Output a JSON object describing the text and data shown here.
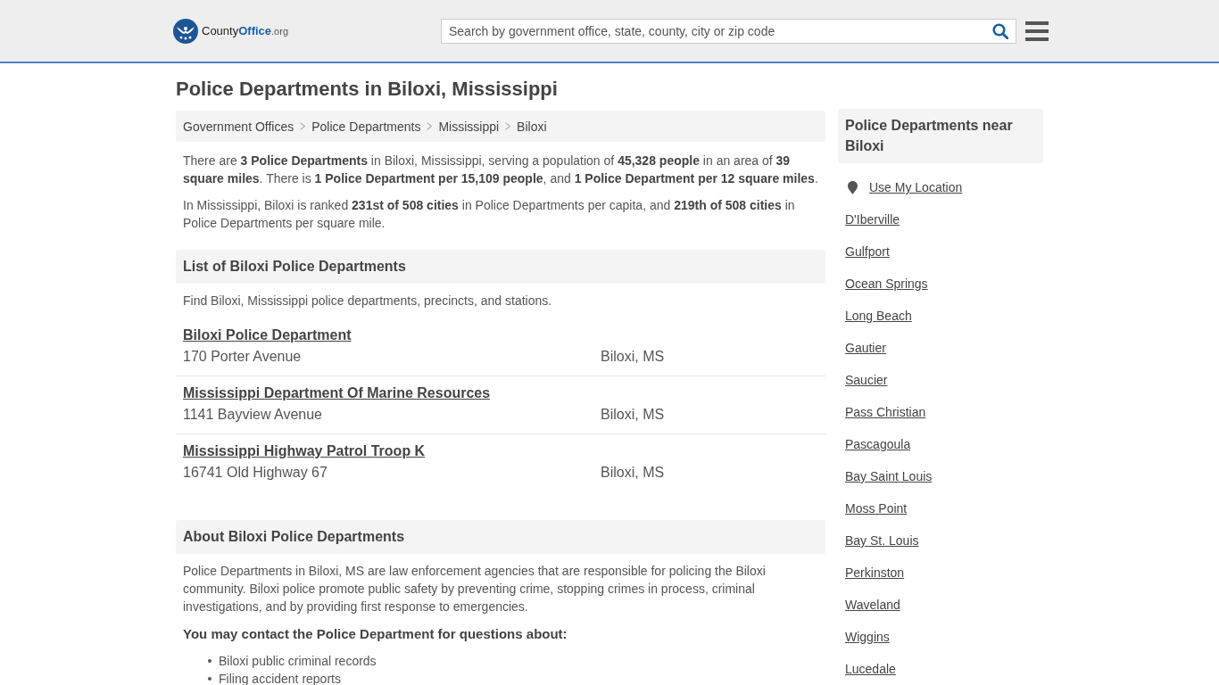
{
  "header": {
    "logo": {
      "parts": [
        "County",
        "Office",
        ".org"
      ]
    },
    "search": {
      "placeholder": "Search by government office, state, county, city or zip code"
    }
  },
  "page_title": "Police Departments in Biloxi, Mississippi",
  "breadcrumb": [
    "Government Offices",
    "Police Departments",
    "Mississippi",
    "Biloxi"
  ],
  "intro": [
    "There are **3 Police Departments** in Biloxi, Mississippi, serving a population of **45,328 people** in an area of **39 square miles**. There is **1 Police Department per 15,109 people**, and **1 Police Department per 12 square miles**.",
    "In Mississippi, Biloxi is ranked **231st of 508 cities** in Police Departments per capita, and **219th of 508 cities** in Police Departments per square mile."
  ],
  "list_section": {
    "heading": "List of Biloxi Police Departments",
    "description": "Find Biloxi, Mississippi police departments, precincts, and stations.",
    "departments": [
      {
        "name": "Biloxi Police Department",
        "address": "170 Porter Avenue",
        "city": "Biloxi, MS"
      },
      {
        "name": "Mississippi Department Of Marine Resources",
        "address": "1141 Bayview Avenue",
        "city": "Biloxi, MS"
      },
      {
        "name": "Mississippi Highway Patrol Troop K",
        "address": "16741 Old Highway 67",
        "city": "Biloxi, MS"
      }
    ]
  },
  "about_section": {
    "heading": "About Biloxi Police Departments",
    "paragraph": "Police Departments in Biloxi, MS are law enforcement agencies that are responsible for policing the Biloxi community. Biloxi police promote public safety by preventing crime, stopping crimes in process, criminal investigations, and by providing first response to emergencies.",
    "subheading": "You may contact the Police Department for questions about:",
    "bullets": [
      "Biloxi public criminal records",
      "Filing accident reports"
    ]
  },
  "sidebar": {
    "heading": "Police Departments near Biloxi",
    "location_link": "Use My Location",
    "cities": [
      "D'Iberville",
      "Gulfport",
      "Ocean Springs",
      "Long Beach",
      "Gautier",
      "Saucier",
      "Pass Christian",
      "Pascagoula",
      "Bay Saint Louis",
      "Moss Point",
      "Bay St. Louis",
      "Perkinston",
      "Waveland",
      "Wiggins",
      "Lucedale"
    ]
  }
}
